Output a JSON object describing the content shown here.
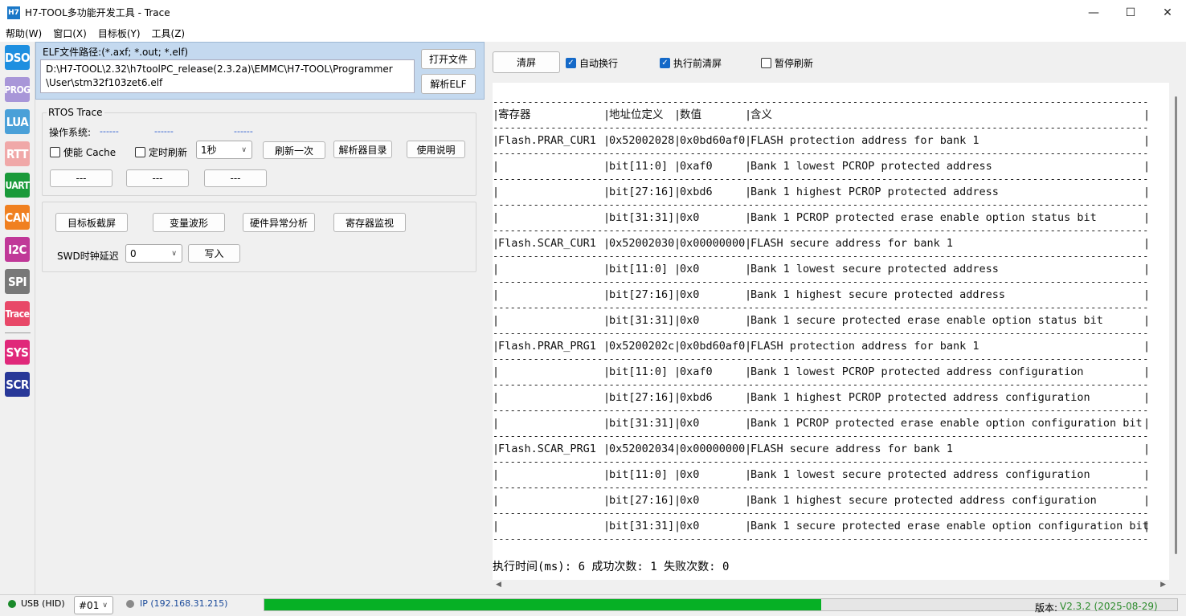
{
  "window": {
    "logo": "H7",
    "title": "H7-TOOL多功能开发工具 - Trace",
    "minimize": "—",
    "maximize": "☐",
    "close": "✕"
  },
  "menu": [
    "帮助(W)",
    "窗口(X)",
    "目标板(Y)",
    "工具(Z)"
  ],
  "sidebar": [
    {
      "label": "DSO",
      "color": "#1e8fe0"
    },
    {
      "label": "PROG",
      "color": "#a896d8"
    },
    {
      "label": "LUA",
      "color": "#4aa0d8"
    },
    {
      "label": "RTT",
      "color": "#f0a8a8"
    },
    {
      "label": "UART",
      "color": "#1a9a3a"
    },
    {
      "label": "CAN",
      "color": "#f08020"
    },
    {
      "label": "I2C",
      "color": "#c03898"
    },
    {
      "label": "SPI",
      "color": "#787878"
    },
    {
      "label": "Trace",
      "color": "#e84868"
    },
    {
      "label": "SYS",
      "color": "#e0287a"
    },
    {
      "label": "SCR",
      "color": "#283898"
    }
  ],
  "elf": {
    "label": "ELF文件路径:(*.axf; *.out; *.elf)",
    "path_line1": "D:\\H7-TOOL\\2.32\\h7toolPC_release(2.3.2a)\\EMMC\\H7-TOOL\\Programmer",
    "path_line2": "\\User\\stm32f103zet6.elf",
    "open_btn": "打开文件",
    "parse_btn": "解析ELF"
  },
  "rtos": {
    "title": "RTOS Trace",
    "os_label": "操作系统:",
    "os_value1": "------",
    "os_value2": "------",
    "os_value3": "------",
    "cache_label": "使能 Cache",
    "timer_label": "定时刷新",
    "interval": "1秒",
    "refresh_btn": "刷新一次",
    "parser_dir_btn": "解析器目录",
    "help_btn": "使用说明",
    "dash_btn1": "---",
    "dash_btn2": "---",
    "dash_btn3": "---"
  },
  "tools": {
    "screenshot_btn": "目标板截屏",
    "wave_btn": "变量波形",
    "hardfault_btn": "硬件异常分析",
    "reg_monitor_btn": "寄存器监视",
    "swd_label": "SWD时钟延迟",
    "swd_value": "0",
    "write_btn": "写入"
  },
  "toolbar": {
    "clear_btn": "清屏",
    "auto_wrap": "自动换行",
    "clear_before": "执行前清屏",
    "pause_refresh": "暂停刷新"
  },
  "table": {
    "headers": [
      "寄存器",
      "地址位定义",
      "数值",
      "含义"
    ],
    "rows": [
      [
        "Flash.PRAR_CUR1",
        "0x52002028",
        "0x0bd60af0",
        "FLASH protection address for bank 1"
      ],
      [
        "",
        "bit[11:0]",
        "0xaf0",
        "Bank 1 lowest PCROP protected address"
      ],
      [
        "",
        "bit[27:16]",
        "0xbd6",
        "Bank 1 highest PCROP protected address"
      ],
      [
        "",
        "bit[31:31]",
        "0x0",
        "Bank 1 PCROP protected erase enable option status bit"
      ],
      [
        "Flash.SCAR_CUR1",
        "0x52002030",
        "0x00000000",
        "FLASH secure address for bank 1"
      ],
      [
        "",
        "bit[11:0]",
        "0x0",
        "Bank 1 lowest secure protected address"
      ],
      [
        "",
        "bit[27:16]",
        "0x0",
        "Bank 1 highest secure protected address"
      ],
      [
        "",
        "bit[31:31]",
        "0x0",
        "Bank 1 secure protected erase enable option status bit"
      ],
      [
        "Flash.PRAR_PRG1",
        "0x5200202c",
        "0x0bd60af0",
        "FLASH protection address for bank 1"
      ],
      [
        "",
        "bit[11:0]",
        "0xaf0",
        "Bank 1 lowest PCROP protected address configuration"
      ],
      [
        "",
        "bit[27:16]",
        "0xbd6",
        "Bank 1 highest PCROP protected address configuration"
      ],
      [
        "",
        "bit[31:31]",
        "0x0",
        "Bank 1 PCROP protected erase enable option configuration bit"
      ],
      [
        "Flash.SCAR_PRG1",
        "0x52002034",
        "0x00000000",
        "FLASH secure address for bank 1"
      ],
      [
        "",
        "bit[11:0]",
        "0x0",
        "Bank 1 lowest secure protected address configuration"
      ],
      [
        "",
        "bit[27:16]",
        "0x0",
        "Bank 1 highest secure protected address configuration"
      ],
      [
        "",
        "bit[31:31]",
        "0x0",
        "Bank 1 secure protected erase enable option configuration bit"
      ]
    ],
    "footer": "执行时间(ms): 6  成功次数: 1 失败次数: 0"
  },
  "status": {
    "usb": "USB (HID)",
    "port": "#01",
    "ip": "IP (192.168.31.215)",
    "progress_percent": 61,
    "version_label": "版本:",
    "version": "V2.3.2 (2025-08-29)",
    "usb_color": "#1a8a2a",
    "ip_color": "#8a8a8a"
  }
}
